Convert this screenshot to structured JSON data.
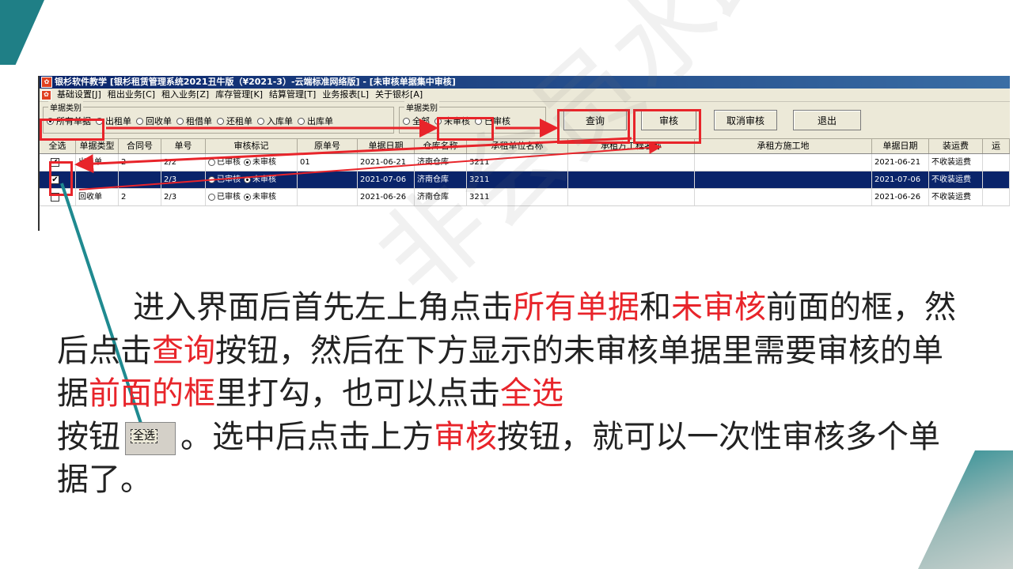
{
  "window": {
    "title": "银杉软件教学  [银杉租赁管理系统2021丑牛版（¥2021-3）-云端标准网络版] - [未审核单据集中审核]"
  },
  "menu": {
    "items": [
      "基础设置[J]",
      "租出业务[C]",
      "租入业务[Z]",
      "库存管理[K]",
      "结算管理[T]",
      "业务报表[L]",
      "关于银杉[A]"
    ]
  },
  "filter1": {
    "group_title": "单据类别",
    "options": [
      {
        "label": "所有单据",
        "checked": true
      },
      {
        "label": "出租单",
        "checked": false
      },
      {
        "label": "回收单",
        "checked": false
      },
      {
        "label": "租借单",
        "checked": false
      },
      {
        "label": "还租单",
        "checked": false
      },
      {
        "label": "入库单",
        "checked": false
      },
      {
        "label": "出库单",
        "checked": false
      }
    ]
  },
  "filter2": {
    "group_title": "单据类别",
    "options": [
      {
        "label": "全部",
        "checked": false
      },
      {
        "label": "未审核",
        "checked": true
      },
      {
        "label": "已审核",
        "checked": false
      }
    ]
  },
  "buttons": {
    "query": "查询",
    "audit": "审核",
    "cancel_audit": "取消审核",
    "exit": "退出"
  },
  "table": {
    "columns": [
      "全选",
      "单据类型",
      "合同号",
      "单号",
      "审核标记",
      "原单号",
      "单据日期",
      "仓库名称",
      "承租单位名称",
      "承租方工程名称",
      "承租方施工地",
      "单据日期",
      "装运费",
      "运"
    ],
    "audit_options": [
      "已审核",
      "未审核"
    ],
    "rows": [
      {
        "checked": true,
        "type": "出租单",
        "contract": "2",
        "no": "2/2",
        "audited": false,
        "orig": "01",
        "date": "2021-06-21",
        "warehouse": "济南仓库",
        "lessee": "3211",
        "project": "",
        "site": "",
        "date2": "2021-06-21",
        "freight": "不收装运费",
        "selected": false
      },
      {
        "checked": true,
        "type": "",
        "contract": "",
        "no": "2/3",
        "audited": false,
        "orig": "",
        "date": "2021-07-06",
        "warehouse": "济南仓库",
        "lessee": "3211",
        "project": "",
        "site": "",
        "date2": "2021-07-06",
        "freight": "不收装运费",
        "selected": true
      },
      {
        "checked": false,
        "type": "回收单",
        "contract": "2",
        "no": "2/3",
        "audited": false,
        "orig": "",
        "date": "2021-06-26",
        "warehouse": "济南仓库",
        "lessee": "3211",
        "project": "",
        "site": "",
        "date2": "2021-06-26",
        "freight": "不收装运费",
        "selected": false
      }
    ]
  },
  "instructions": {
    "line1_indent": "进入界面后首先左上角点击",
    "hl_all_docs": "所有单据",
    "and": "和",
    "hl_unaudited": "未审核",
    "t1": "前面的框，然后点击",
    "hl_query": "查询",
    "t2": "按钮，然后在下方显示的未审核单据里需要审核的单据",
    "hl_front_box": "前面的框",
    "t3": "里打勾，也可以点击",
    "hl_select_all": "全选",
    "t4": "按钮",
    "select_all_btn": "全选",
    "t5": "。选中后点击上方",
    "hl_audit": "审核",
    "t6": "按钮，就可以一次性审核多个单据了。"
  },
  "watermark": "非会员水印",
  "colors": {
    "accent": "#1f7f86",
    "highlight": "#e8242a",
    "titlebar": "#0a246a"
  }
}
